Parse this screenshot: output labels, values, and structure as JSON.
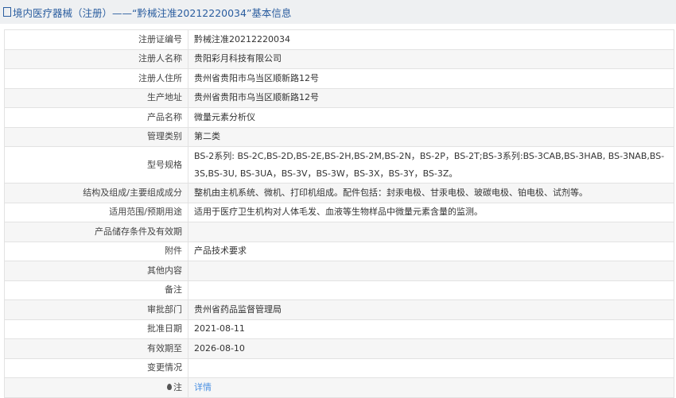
{
  "header": {
    "title": "境内医疗器械（注册）——“黔械注准20212220034”基本信息"
  },
  "rows": [
    {
      "label": "注册证编号",
      "value": "黔械注准20212220034"
    },
    {
      "label": "注册人名称",
      "value": "贵阳彩月科技有限公司"
    },
    {
      "label": "注册人住所",
      "value": "贵州省贵阳市乌当区顺新路12号"
    },
    {
      "label": "生产地址",
      "value": "贵州省贵阳市乌当区顺新路12号"
    },
    {
      "label": "产品名称",
      "value": "微量元素分析仪"
    },
    {
      "label": "管理类别",
      "value": "第二类"
    },
    {
      "label": "型号规格",
      "value": "BS-2系列: BS-2C,BS-2D,BS-2E,BS-2H,BS-2M,BS-2N，BS-2P，BS-2T;BS-3系列:BS-3CAB,BS-3HAB, BS-3NAB,BS-3S,BS-3U, BS-3UA，BS-3V，BS-3W，BS-3X，BS-3Y，BS-3Z。"
    },
    {
      "label": "结构及组成/主要组成成分",
      "value": "整机由主机系统、微机、打印机组成。配件包括：封汞电极、甘汞电极、玻碳电极、铂电极、试剂等。"
    },
    {
      "label": "适用范围/预期用途",
      "value": "适用于医疗卫生机构对人体毛发、血液等生物样品中微量元素含量的监测。"
    },
    {
      "label": "产品储存条件及有效期",
      "value": ""
    },
    {
      "label": "附件",
      "value": "产品技术要求"
    },
    {
      "label": "其他内容",
      "value": ""
    },
    {
      "label": "备注",
      "value": ""
    },
    {
      "label": "审批部门",
      "value": "贵州省药品监督管理局"
    },
    {
      "label": "批准日期",
      "value": "2021-08-11"
    },
    {
      "label": "有效期至",
      "value": "2026-08-10"
    },
    {
      "label": "变更情况",
      "value": ""
    }
  ],
  "note": {
    "label": "注",
    "link": "详情"
  }
}
